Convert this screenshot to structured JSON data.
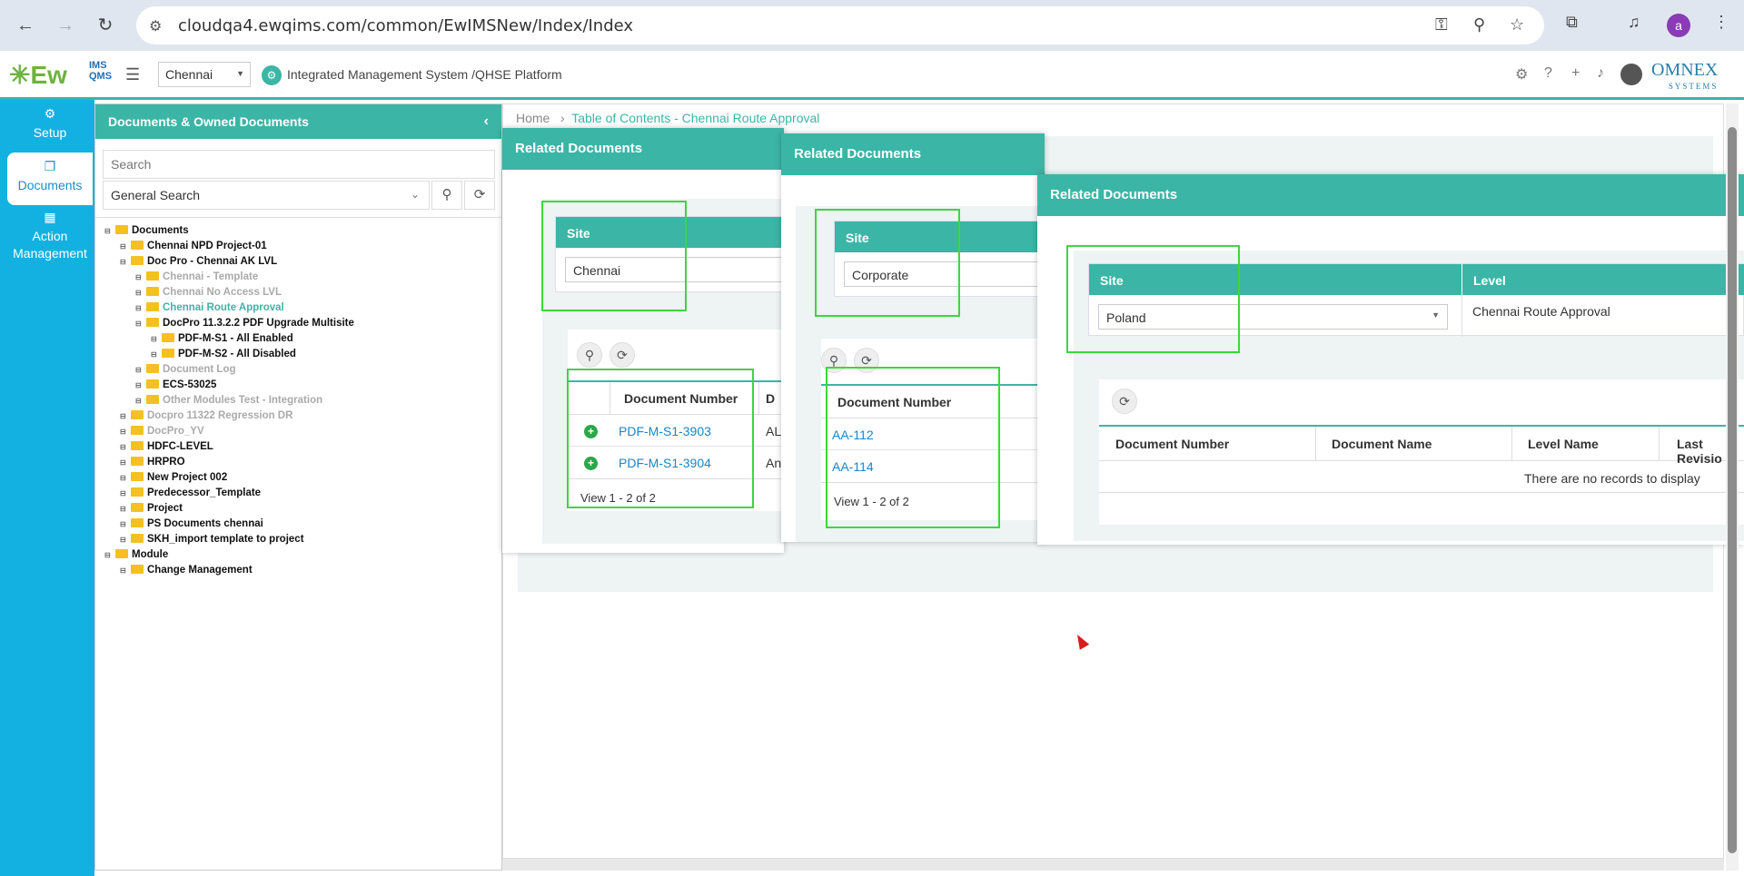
{
  "browser": {
    "url": "cloudqa4.ewqims.com/common/EwIMSNew/Index/Index",
    "profile_initial": "a"
  },
  "header": {
    "logo_text": "Ew",
    "logo_sub": "IMS QMS",
    "site": "Chennai",
    "platform_title": "Integrated Management System /QHSE Platform",
    "company": "OMNEX",
    "company_sub": "SYSTEMS"
  },
  "rail": {
    "items": [
      {
        "label": "Setup",
        "icon": "gears-icon"
      },
      {
        "label": "Documents",
        "icon": "documents-icon"
      },
      {
        "label": "Action Management",
        "icon": "building-icon"
      }
    ]
  },
  "docs_panel": {
    "title": "Documents & Owned Documents",
    "search_placeholder": "Search",
    "search_type": "General Search",
    "tree": [
      {
        "label": "Documents",
        "level": 0,
        "style": "normal"
      },
      {
        "label": "Chennai NPD Project-01",
        "level": 1,
        "style": "normal"
      },
      {
        "label": "Doc Pro - Chennai AK LVL",
        "level": 1,
        "style": "normal"
      },
      {
        "label": "Chennai - Template",
        "level": 2,
        "style": "grey"
      },
      {
        "label": "Chennai No Access LVL",
        "level": 2,
        "style": "grey"
      },
      {
        "label": "Chennai Route Approval",
        "level": 2,
        "style": "teal"
      },
      {
        "label": "DocPro 11.3.2.2 PDF Upgrade Multisite",
        "level": 2,
        "style": "normal"
      },
      {
        "label": "PDF-M-S1 - All Enabled",
        "level": 3,
        "style": "normal"
      },
      {
        "label": "PDF-M-S2 - All Disabled",
        "level": 3,
        "style": "normal"
      },
      {
        "label": "Document Log",
        "level": 2,
        "style": "grey"
      },
      {
        "label": "ECS-53025",
        "level": 2,
        "style": "normal"
      },
      {
        "label": "Other Modules Test - Integration",
        "level": 2,
        "style": "grey"
      },
      {
        "label": "Docpro 11322 Regression DR",
        "level": 1,
        "style": "grey"
      },
      {
        "label": "DocPro_YV",
        "level": 1,
        "style": "grey"
      },
      {
        "label": "HDFC-LEVEL",
        "level": 1,
        "style": "normal"
      },
      {
        "label": "HRPRO",
        "level": 1,
        "style": "normal"
      },
      {
        "label": "New Project 002",
        "level": 1,
        "style": "normal"
      },
      {
        "label": "Predecessor_Template",
        "level": 1,
        "style": "normal"
      },
      {
        "label": "Project",
        "level": 1,
        "style": "normal"
      },
      {
        "label": "PS Documents chennai",
        "level": 1,
        "style": "normal"
      },
      {
        "label": "SKH_import template to project",
        "level": 1,
        "style": "normal"
      },
      {
        "label": "Module",
        "level": 0,
        "style": "normal"
      },
      {
        "label": "Change Management",
        "level": 1,
        "style": "normal"
      }
    ]
  },
  "breadcrumb": {
    "home": "Home",
    "sep": "›",
    "current": "Table of Contents - Chennai Route Approval"
  },
  "dialogs": {
    "d1": {
      "title": "Related Documents",
      "site_label": "Site",
      "site_value": "Chennai",
      "col_doc_number": "Document Number",
      "col_next": "D",
      "rows": [
        {
          "number": "PDF-M-S1-3903",
          "next": "AL"
        },
        {
          "number": "PDF-M-S1-3904",
          "next": "An"
        }
      ],
      "pager": "View 1 - 2 of 2"
    },
    "d2": {
      "title": "Related Documents",
      "site_label": "Site",
      "site_value": "Corporate",
      "col_doc_number": "Document Number",
      "rows": [
        {
          "number": "AA-112"
        },
        {
          "number": "AA-114"
        }
      ],
      "pager": "View 1 - 2 of 2"
    },
    "d3": {
      "title": "Related Documents",
      "site_label": "Site",
      "site_value": "Poland",
      "level_label": "Level",
      "level_value": "Chennai Route Approval",
      "columns": [
        "Document Number",
        "Document Name",
        "Level Name",
        "Last Revisio"
      ],
      "empty_message": "There are no records to display"
    }
  },
  "colors": {
    "teal": "#3bb5a6",
    "rail": "#12b1e2",
    "highlight": "#3ed63e",
    "link": "#1a84c7"
  }
}
